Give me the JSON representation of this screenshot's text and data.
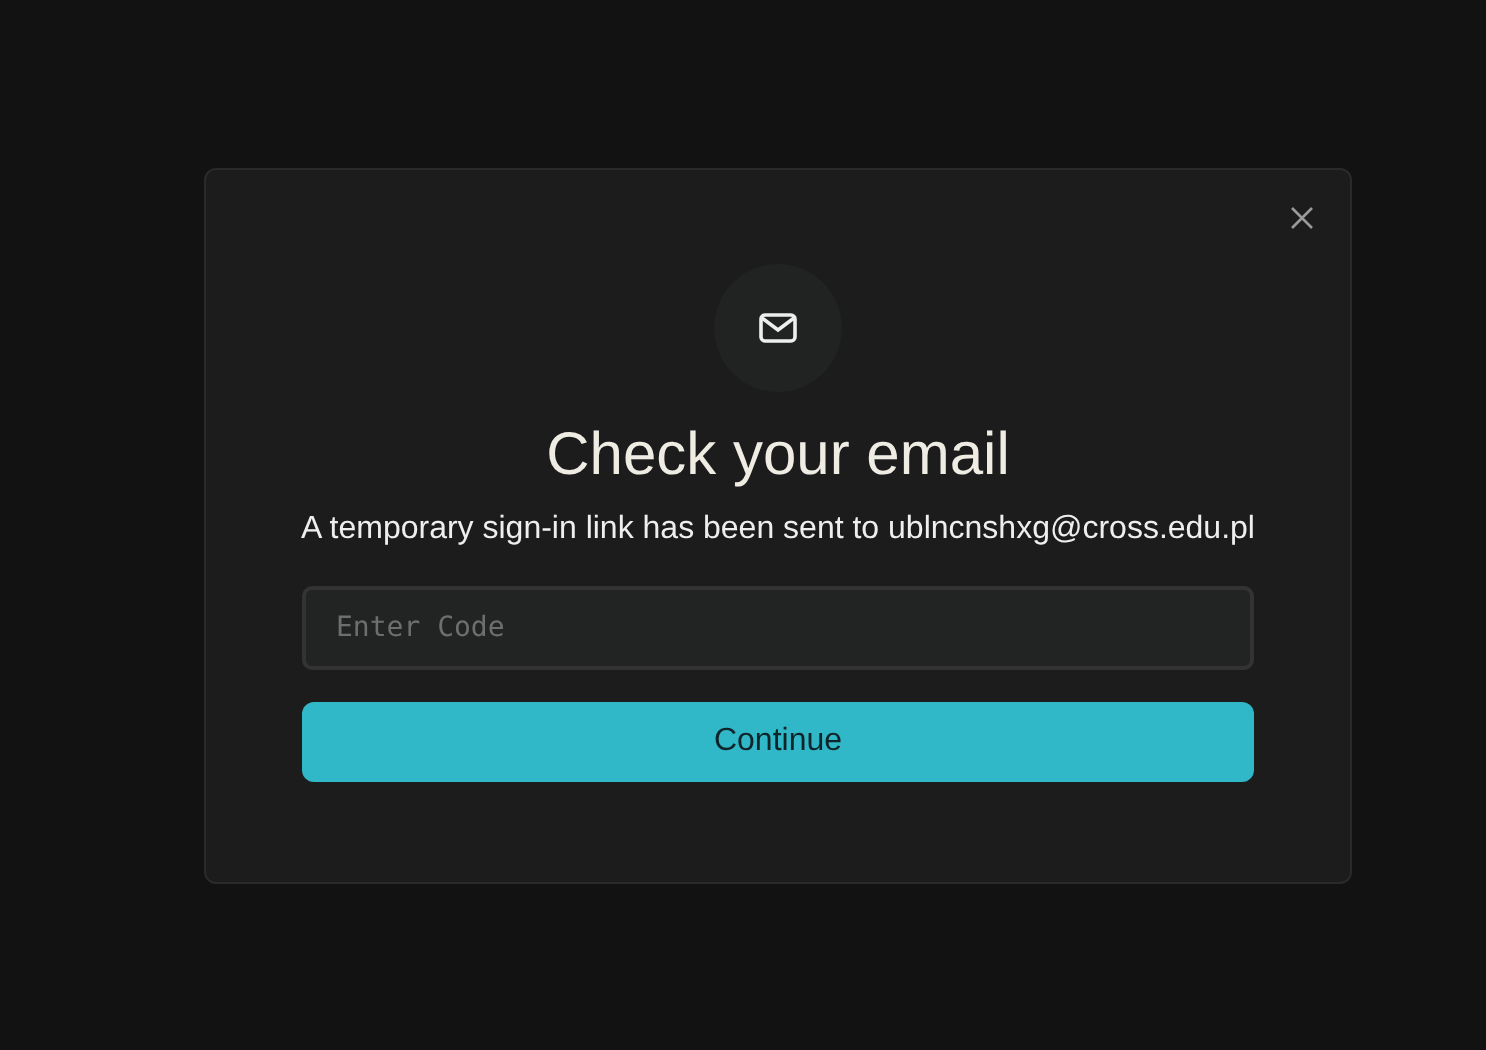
{
  "dialog": {
    "title": "Check your email",
    "message": "A temporary sign-in link has been sent to ublncnshxg@cross.edu.pl",
    "code_field": {
      "placeholder": "Enter Code"
    },
    "buttons": [
      "Continue"
    ]
  }
}
